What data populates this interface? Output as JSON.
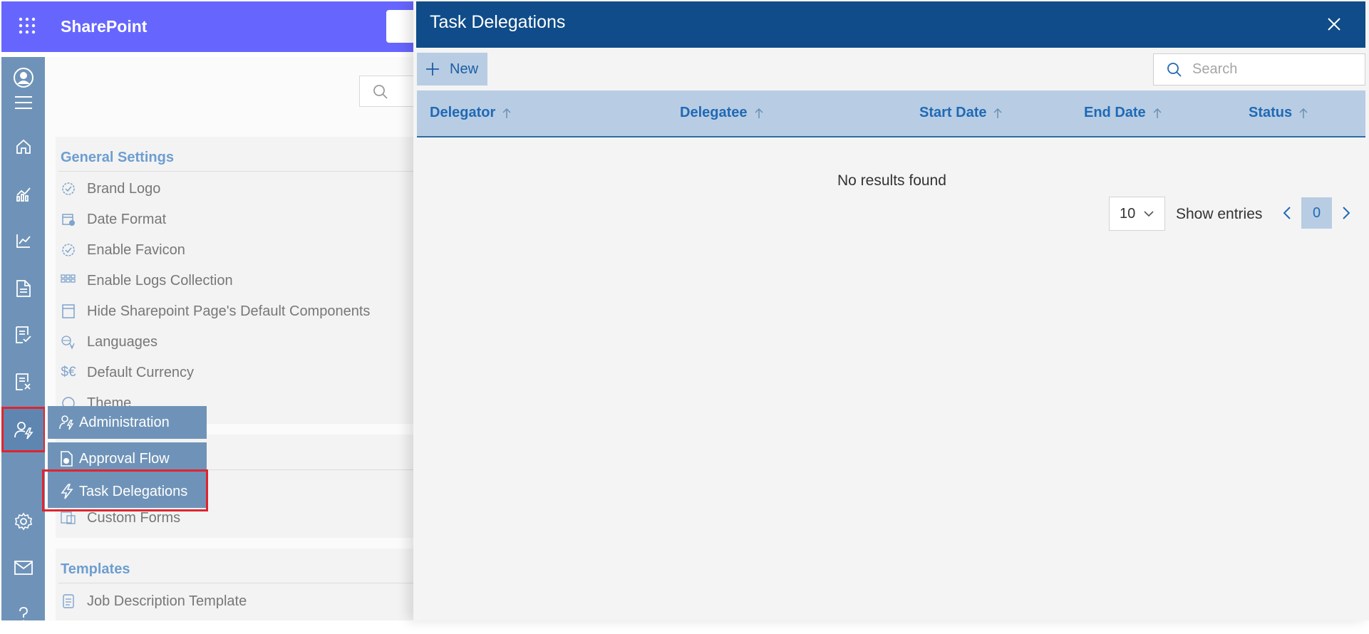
{
  "suite": {
    "brand": "SharePoint"
  },
  "settings": {
    "general_title": "General Settings",
    "general_items": [
      {
        "label": "Brand Logo",
        "icon": "badge-check-icon"
      },
      {
        "label": "Date Format",
        "icon": "calendar-clock-icon"
      },
      {
        "label": "Enable Favicon",
        "icon": "badge-check-icon"
      },
      {
        "label": "Enable Logs Collection",
        "icon": "grid-icon"
      },
      {
        "label": "Hide Sharepoint Page's Default Components",
        "icon": "window-icon"
      },
      {
        "label": "Languages",
        "icon": "translate-icon"
      },
      {
        "label": "Default Currency",
        "icon": "currency-icon"
      },
      {
        "label": "Theme",
        "icon": "palette-icon"
      }
    ],
    "custom_forms_label": "Custom Forms",
    "templates_title": "Templates",
    "templates_items": [
      {
        "label": "Job Description Template",
        "icon": "document-icon"
      }
    ]
  },
  "flyout": {
    "items": [
      {
        "label": "Administration",
        "icon": "person-admin-icon"
      },
      {
        "label": "Approval Flow",
        "icon": "document-check-icon"
      },
      {
        "label": "Task Delegations",
        "icon": "lightning-icon"
      }
    ]
  },
  "panel": {
    "title": "Task Delegations",
    "new_label": "New",
    "search_placeholder": "Search",
    "columns": [
      "Delegator",
      "Delegatee",
      "Start Date",
      "End Date",
      "Status"
    ],
    "empty_message": "No results found",
    "page_size": "10",
    "show_entries": "Show entries",
    "current_page": "0"
  },
  "colors": {
    "suite_bar": "#6666ff",
    "rail": "#6f93b8",
    "panel_header": "#0f4c89",
    "accent": "#2069b5",
    "highlight": "#e0242e"
  }
}
